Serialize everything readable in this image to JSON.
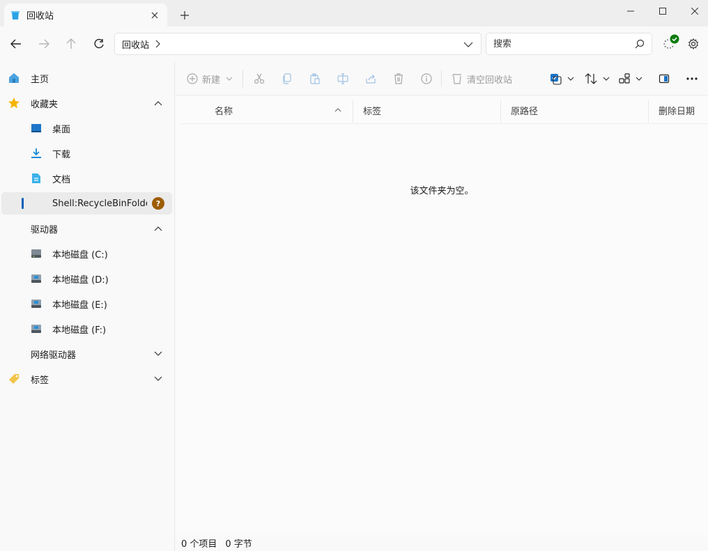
{
  "tab": {
    "title": "回收站",
    "close_symbol": "✕",
    "new_tab_symbol": "+"
  },
  "window_controls": {
    "minimize": "—",
    "maximize": "☐",
    "close": "✕"
  },
  "nav": {
    "address": {
      "path": "回收站",
      "separator": "›"
    },
    "search": {
      "placeholder": "搜索",
      "value": ""
    }
  },
  "sidebar": {
    "home": {
      "label": "主页",
      "icon": "home-icon"
    },
    "favorites": {
      "label": "收藏夹",
      "icon": "star-icon",
      "expanded": true
    },
    "favorite_items": [
      {
        "label": "桌面",
        "icon": "desktop-icon"
      },
      {
        "label": "下载",
        "icon": "download-icon"
      },
      {
        "label": "文档",
        "icon": "document-icon"
      },
      {
        "label": "Shell:RecycleBinFolder",
        "icon": "recycle-bin-icon",
        "selected": true,
        "badge": "?"
      }
    ],
    "drives": {
      "label": "驱动器",
      "expanded": true
    },
    "drive_items": [
      {
        "label": "本地磁盘 (C:)"
      },
      {
        "label": "本地磁盘 (D:)"
      },
      {
        "label": "本地磁盘 (E:)"
      },
      {
        "label": "本地磁盘 (F:)"
      }
    ],
    "network": {
      "label": "网络驱动器",
      "expanded": false
    },
    "tags": {
      "label": "标签",
      "icon": "tag-icon",
      "expanded": false
    }
  },
  "commands": {
    "new_label": "新建",
    "empty_bin_label": "清空回收站"
  },
  "columns": [
    {
      "label": "名称",
      "sorted": "ascending"
    },
    {
      "label": "标签"
    },
    {
      "label": "原路径"
    },
    {
      "label": "删除日期"
    }
  ],
  "empty_message": "该文件夹为空。",
  "status": {
    "item_count": "0 个项目",
    "size": "0 字节"
  },
  "colors": {
    "accent": "#005fb8",
    "badge": "#9d5d00",
    "star": "#f5b400",
    "ok_badge": "#0f7b0f"
  }
}
